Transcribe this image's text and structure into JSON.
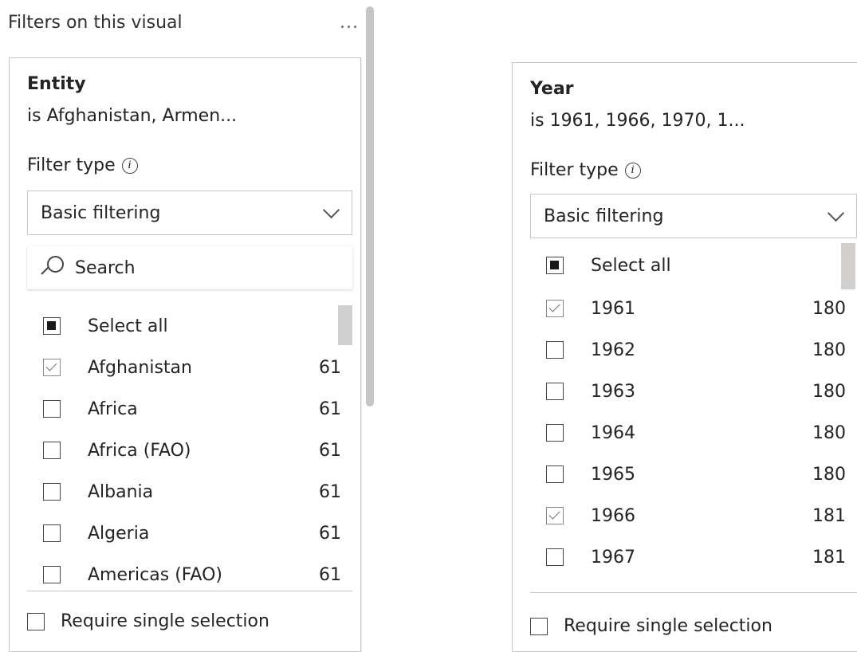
{
  "pane": {
    "title": "Filters on this visual",
    "more": "..."
  },
  "cards": [
    {
      "title": "Entity",
      "summary": "is Afghanistan, Armen...",
      "filter_type_label": "Filter type",
      "filter_type_value": "Basic filtering",
      "search_placeholder": "Search",
      "select_all": "Select all",
      "items": [
        {
          "label": "Afghanistan",
          "count": "61",
          "checked": true
        },
        {
          "label": "Africa",
          "count": "61",
          "checked": false
        },
        {
          "label": "Africa (FAO)",
          "count": "61",
          "checked": false
        },
        {
          "label": "Albania",
          "count": "61",
          "checked": false
        },
        {
          "label": "Algeria",
          "count": "61",
          "checked": false
        },
        {
          "label": "Americas (FAO)",
          "count": "61",
          "checked": false
        }
      ],
      "require_single": "Require single selection"
    },
    {
      "title": "Year",
      "summary": "is 1961, 1966, 1970, 1...",
      "filter_type_label": "Filter type",
      "filter_type_value": "Basic filtering",
      "select_all": "Select all",
      "items": [
        {
          "label": "1961",
          "count": "180",
          "checked": true
        },
        {
          "label": "1962",
          "count": "180",
          "checked": false
        },
        {
          "label": "1963",
          "count": "180",
          "checked": false
        },
        {
          "label": "1964",
          "count": "180",
          "checked": false
        },
        {
          "label": "1965",
          "count": "180",
          "checked": false
        },
        {
          "label": "1966",
          "count": "181",
          "checked": true
        },
        {
          "label": "1967",
          "count": "181",
          "checked": false
        }
      ],
      "require_single": "Require single selection"
    }
  ],
  "icons": {
    "info": "info-icon",
    "dropdown": "chevron-down-icon",
    "search": "search-icon",
    "more": "more-options-icon"
  }
}
